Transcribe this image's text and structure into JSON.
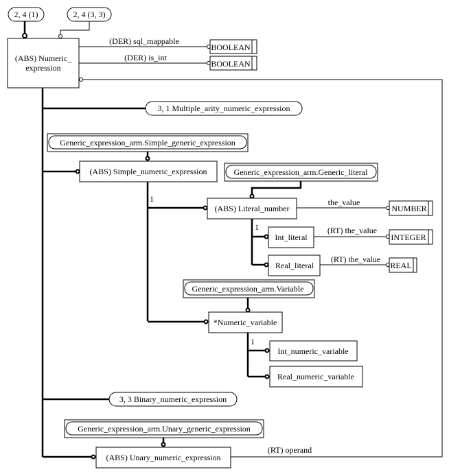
{
  "diagram": {
    "page_refs": [
      {
        "id": "ref-2-4-1",
        "label": "2, 4 (1)"
      },
      {
        "id": "ref-2-4-3-3",
        "label": "2, 4 (3, 3)"
      }
    ],
    "entities": {
      "numeric_expression": {
        "line1": "(ABS) Numeric_",
        "line2": "expression"
      },
      "simple_numeric_expression": "(ABS) Simple_numeric_expression",
      "literal_number": "(ABS) Literal_number",
      "int_literal": "Int_literal",
      "real_literal": "Real_literal",
      "numeric_variable": "*Numeric_variable",
      "int_numeric_variable": "Int_numeric_variable",
      "real_numeric_variable": "Real_numeric_variable",
      "unary_numeric_expression": "(ABS) Unary_numeric_expression"
    },
    "external_refs": {
      "simple_generic_expression": "Generic_expression_arm.Simple_generic_expression",
      "generic_literal": "Generic_expression_arm.Generic_literal",
      "variable": "Generic_expression_arm.Variable",
      "unary_generic_expression": "Generic_expression_arm.Unary_generic_expression"
    },
    "off_page_refs": {
      "multiple_arity": "3, 1 Multiple_arity_numeric_expression",
      "binary": "3, 3 Binary_numeric_expression"
    },
    "types": {
      "boolean1": "BOOLEAN",
      "boolean2": "BOOLEAN",
      "number": "NUMBER",
      "integer": "INTEGER",
      "real": "REAL"
    },
    "attributes": {
      "sql_mappable": "(DER) sql_mappable",
      "is_int": "(DER) is_int",
      "the_value": "the_value",
      "int_the_value": "(RT) the_value",
      "real_the_value": "(RT) the_value",
      "operand": "(RT) operand"
    },
    "cardinalities": {
      "simple_one": "1",
      "literal_one": "1",
      "variable_one": "1"
    }
  }
}
